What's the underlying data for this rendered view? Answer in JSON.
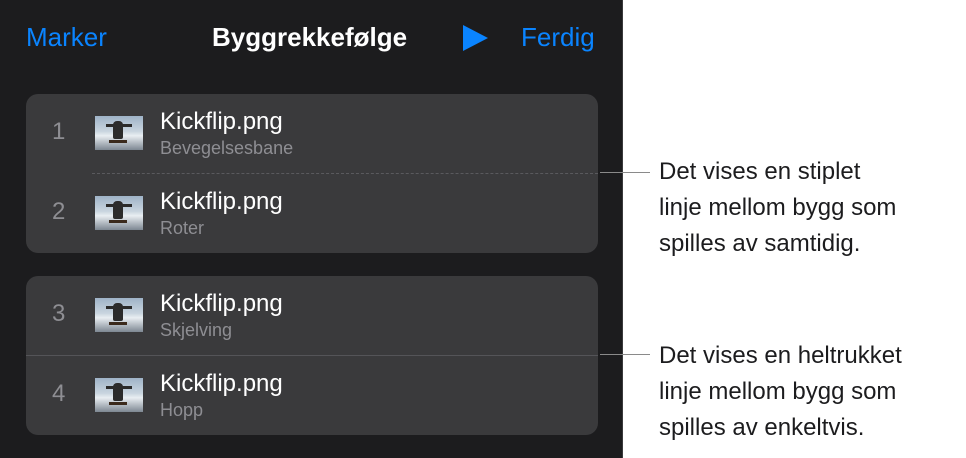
{
  "header": {
    "select_label": "Marker",
    "title": "Byggrekkefølge",
    "play_icon": "play-icon",
    "done_label": "Ferdig"
  },
  "colors": {
    "accent": "#0a84ff",
    "panel_bg": "#1c1c1e",
    "group_bg": "#3a3a3c"
  },
  "groups": [
    {
      "separator": "dashed",
      "builds": [
        {
          "number": "1",
          "file": "Kickflip.png",
          "effect": "Bevegelsesbane"
        },
        {
          "number": "2",
          "file": "Kickflip.png",
          "effect": "Roter"
        }
      ]
    },
    {
      "separator": "solid",
      "builds": [
        {
          "number": "3",
          "file": "Kickflip.png",
          "effect": "Skjelving"
        },
        {
          "number": "4",
          "file": "Kickflip.png",
          "effect": "Hopp"
        }
      ]
    }
  ],
  "callouts": [
    {
      "lines": [
        "Det vises en stiplet",
        "linje mellom bygg som",
        "spilles av samtidig."
      ]
    },
    {
      "lines": [
        "Det vises en heltrukket",
        "linje mellom bygg som",
        "spilles av enkeltvis."
      ]
    }
  ]
}
